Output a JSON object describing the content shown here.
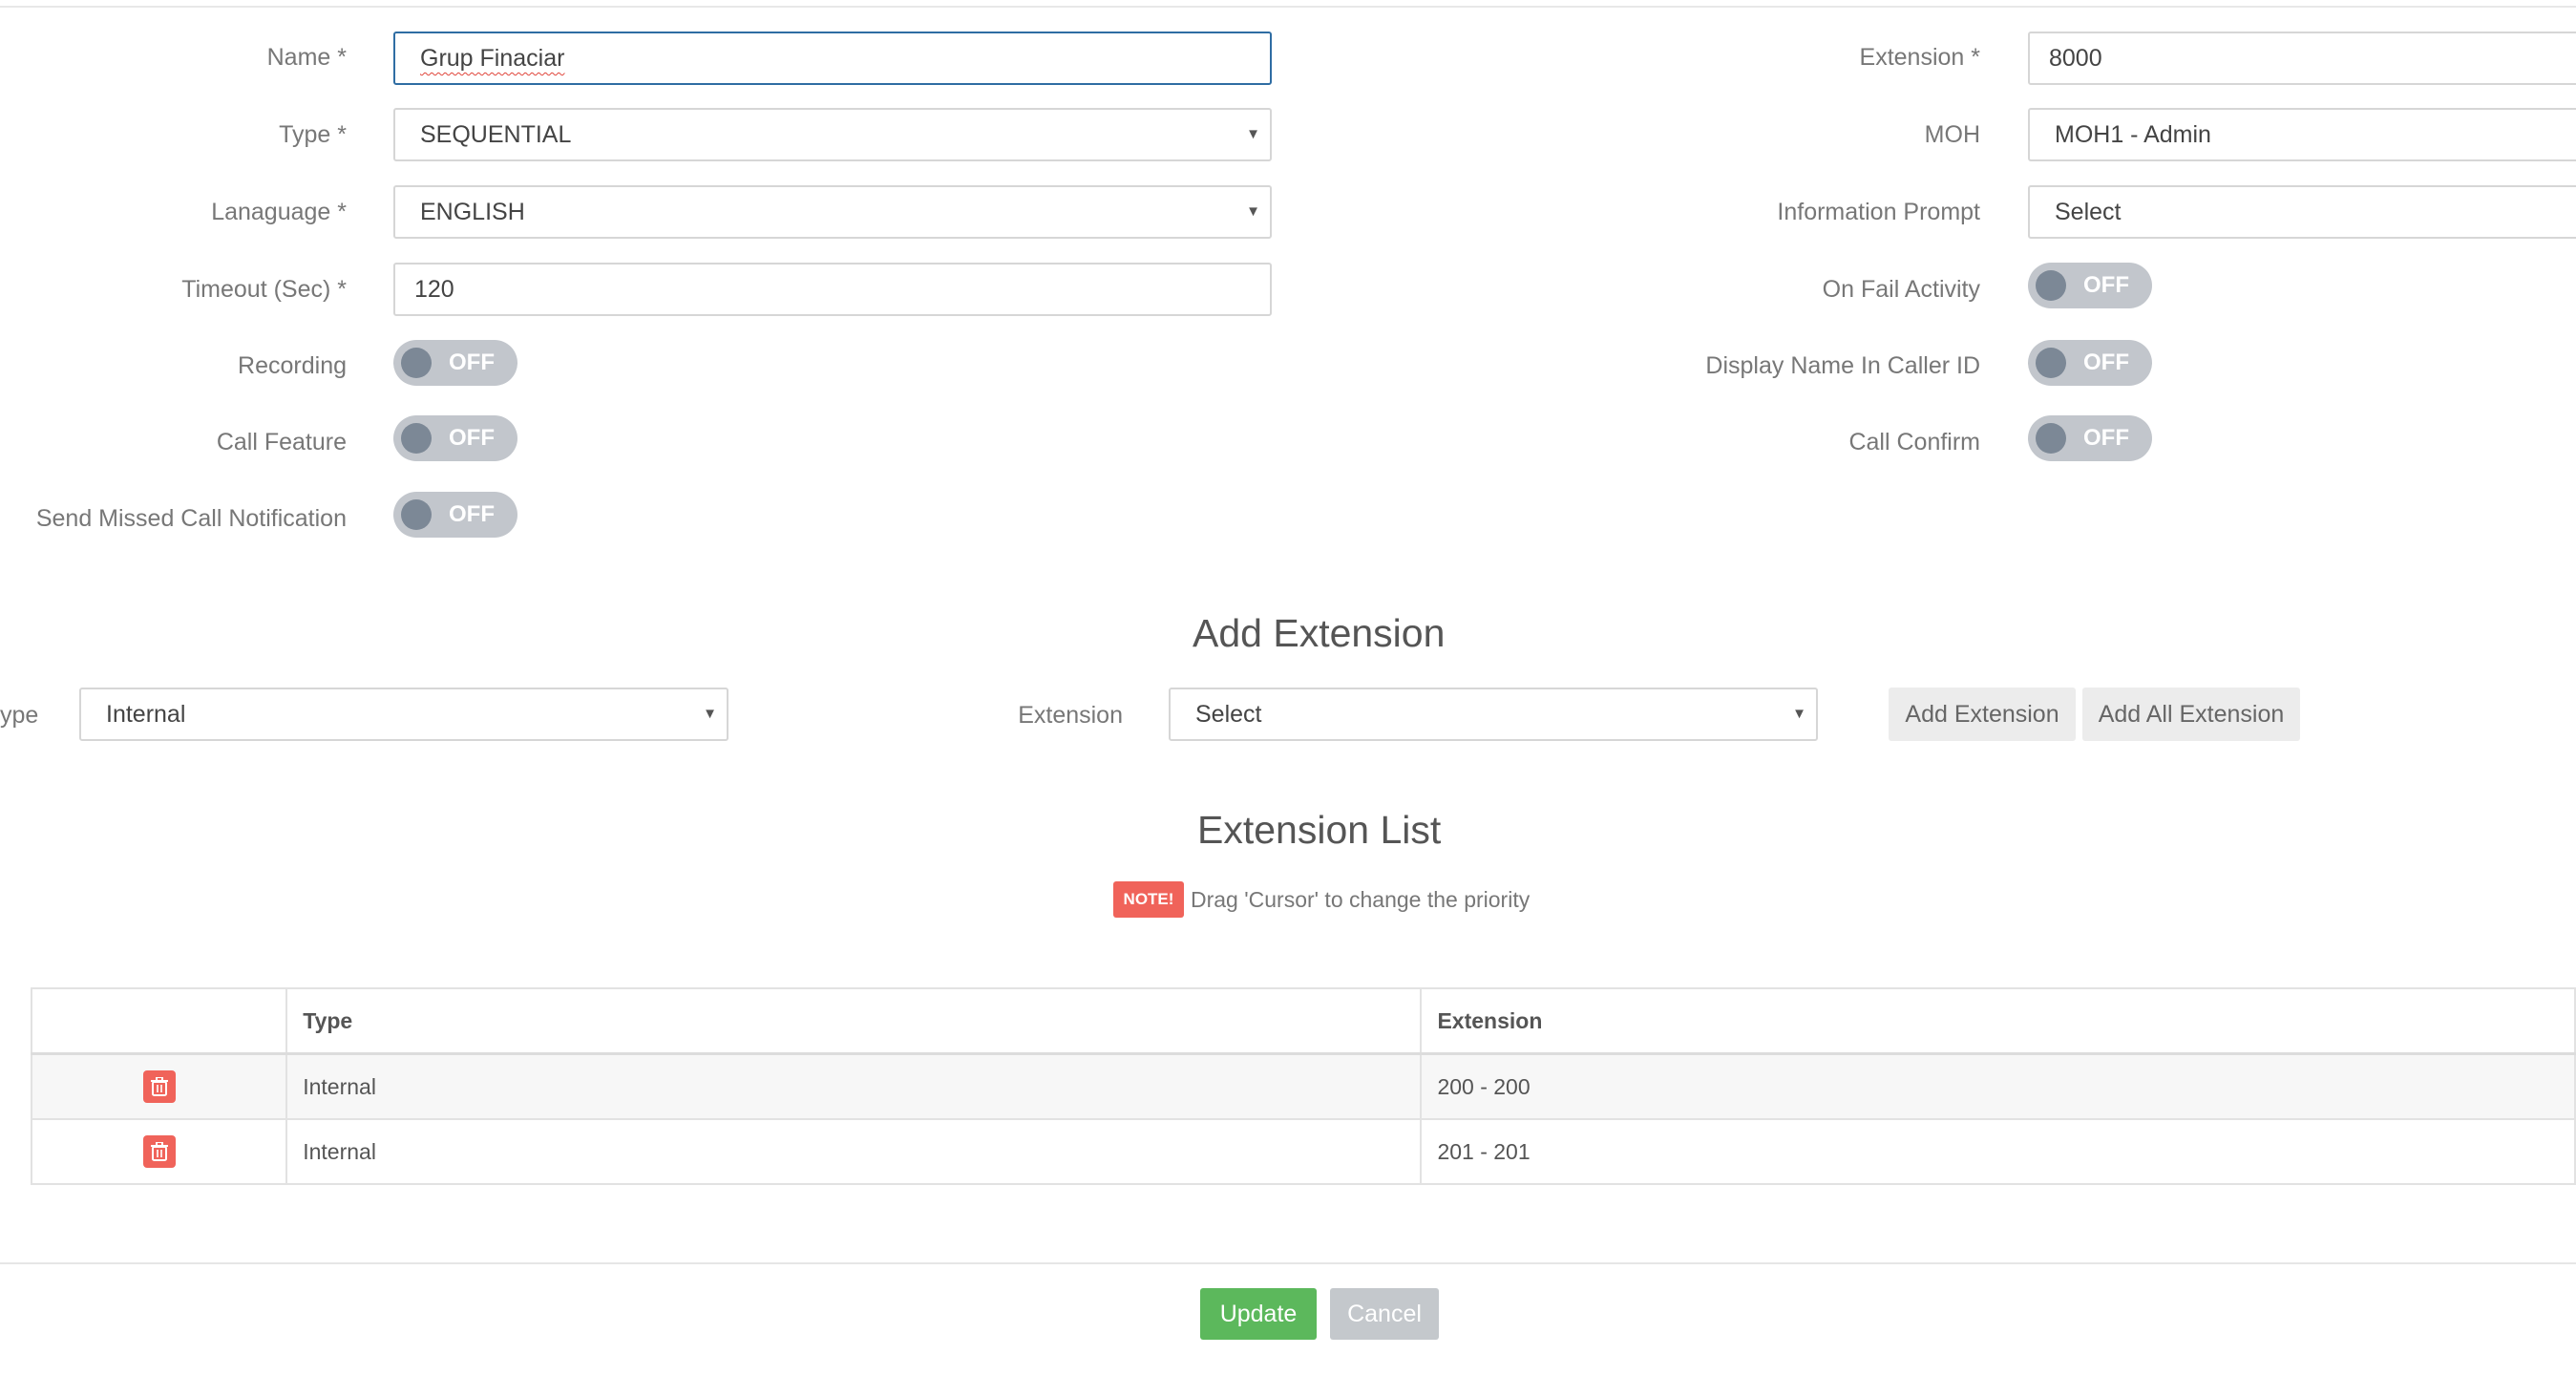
{
  "form": {
    "name_label": "Name *",
    "name_value": "Grup Finaciar",
    "type_label": "Type *",
    "type_value": "SEQUENTIAL",
    "language_label": "Lanaguage *",
    "language_value": "ENGLISH",
    "timeout_label": "Timeout (Sec) *",
    "timeout_value": "120",
    "recording_label": "Recording",
    "call_feature_label": "Call Feature",
    "send_missed_label": "Send Missed Call Notification",
    "extension_label": "Extension *",
    "extension_value": "8000",
    "moh_label": "MOH",
    "moh_value": "MOH1 - Admin",
    "info_prompt_label": "Information Prompt",
    "info_prompt_value": "Select",
    "on_fail_label": "On Fail Activity",
    "display_name_label": "Display Name In Caller ID",
    "call_confirm_label": "Call Confirm",
    "toggle_off": "OFF"
  },
  "add_extension": {
    "heading": "Add Extension",
    "type_label": "ype",
    "type_value": "Internal",
    "extension_label": "Extension",
    "extension_value": "Select",
    "add_button": "Add Extension",
    "add_all_button": "Add All Extension"
  },
  "extension_list": {
    "heading": "Extension List",
    "note_badge": "NOTE!",
    "note_text": "Drag 'Cursor' to change the priority",
    "columns": [
      "",
      "Type",
      "Extension"
    ],
    "rows": [
      {
        "type": "Internal",
        "extension": "200 - 200"
      },
      {
        "type": "Internal",
        "extension": "201 - 201"
      }
    ]
  },
  "actions": {
    "update": "Update",
    "cancel": "Cancel"
  },
  "colors": {
    "primary_focus": "#2f6da3",
    "danger": "#f0635a",
    "success": "#5cb85c",
    "toggle_off": "#c2c6cc"
  }
}
